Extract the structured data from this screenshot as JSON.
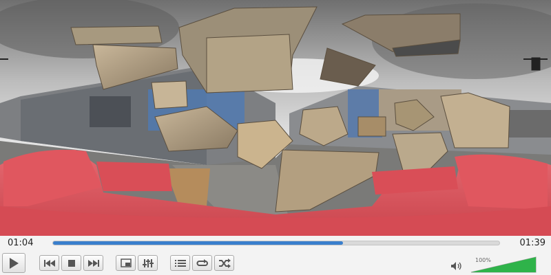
{
  "player": {
    "time_elapsed": "01:04",
    "time_total": "01:39",
    "progress_fraction": 0.65,
    "volume_label": "100%",
    "volume_level": 1.0,
    "colors": {
      "seek_fill": "#3a7fcd",
      "volume_fill": "#2fb34a",
      "sofa": "#e0575f"
    }
  },
  "controls": {
    "icons": [
      "play-icon",
      "previous-icon",
      "stop-icon",
      "next-icon",
      "fullscreen-icon",
      "extended-settings-icon",
      "playlist-icon",
      "loop-icon",
      "shuffle-icon",
      "volume-icon"
    ]
  }
}
